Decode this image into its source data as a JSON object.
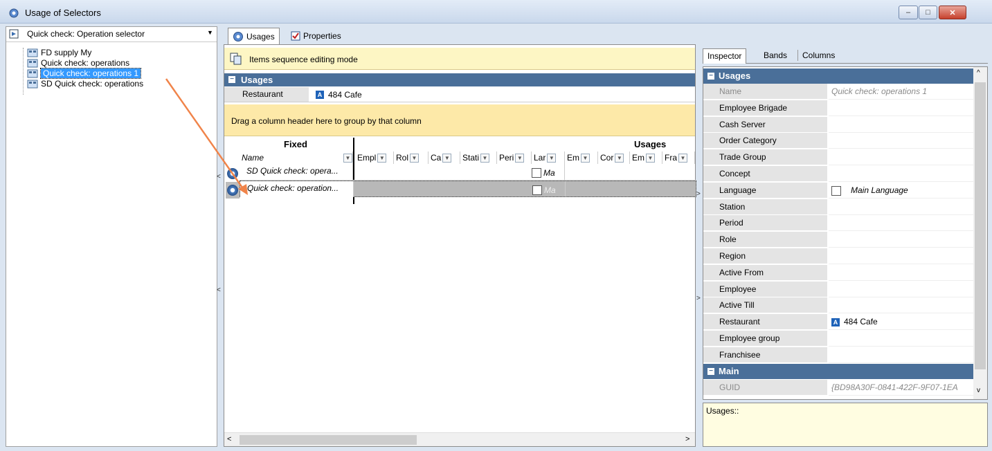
{
  "window": {
    "title": "Usage of Selectors",
    "min": "–",
    "max": "□",
    "close": "✕"
  },
  "left": {
    "combo": {
      "value": "Quick check: Operation selector",
      "icon": "selector-icon"
    },
    "tree": [
      {
        "label": "FD supply My"
      },
      {
        "label": "Quick check: operations"
      },
      {
        "label": "Quick check: operations 1",
        "selected": true
      },
      {
        "label": "SD Quick check: operations"
      }
    ]
  },
  "tabs": {
    "usages": "Usages",
    "properties": "Properties"
  },
  "center": {
    "mode_text": "Items sequence editing mode",
    "usages_header": "Usages",
    "restaurant_label": "Restaurant",
    "restaurant_value": "484 Cafe",
    "group_hint": "Drag a column header here to group by that column",
    "bands": {
      "fixed": "Fixed",
      "usages": "Usages"
    },
    "columns": [
      "Name",
      "Empl",
      "Rol",
      "Ca",
      "Stati",
      "Peri",
      "Lar",
      "Em",
      "Cor",
      "Em",
      "Fra"
    ],
    "rows": [
      {
        "name": "SD Quick check: opera...",
        "lang": "Ma",
        "selected": false
      },
      {
        "name": "Quick check: operation...",
        "lang": "Ma",
        "selected": true
      }
    ]
  },
  "inspector": {
    "tabs": {
      "inspector": "Inspector",
      "bands": "Bands",
      "columns": "Columns"
    },
    "section_usages": "Usages",
    "section_main": "Main",
    "props": [
      {
        "name": "Name",
        "value": "Quick check: operations 1",
        "dim": true
      },
      {
        "name": "Employee Brigade",
        "value": ""
      },
      {
        "name": "Cash Server",
        "value": ""
      },
      {
        "name": "Order Category",
        "value": ""
      },
      {
        "name": "Trade Group",
        "value": ""
      },
      {
        "name": "Concept",
        "value": ""
      },
      {
        "name": "Language",
        "value": "Main Language",
        "checkbox": true
      },
      {
        "name": "Station",
        "value": ""
      },
      {
        "name": "Period",
        "value": ""
      },
      {
        "name": "Role",
        "value": ""
      },
      {
        "name": "Region",
        "value": ""
      },
      {
        "name": "Active From",
        "value": ""
      },
      {
        "name": "Employee",
        "value": ""
      },
      {
        "name": "Active Till",
        "value": ""
      },
      {
        "name": "Restaurant",
        "value": "484 Cafe",
        "icon": true
      },
      {
        "name": "Employee group",
        "value": ""
      },
      {
        "name": "Franchisee",
        "value": ""
      }
    ],
    "main_props": [
      {
        "name": "GUID",
        "value": "{BD98A30F-0841-422F-9F07-1EA"
      }
    ],
    "description": "Usages::"
  },
  "colors": {
    "header_blue": "#4a6f99",
    "selection": "#3399ff",
    "annotation_arrow": "#f0844a",
    "yellow_bar": "#fde9a8"
  }
}
